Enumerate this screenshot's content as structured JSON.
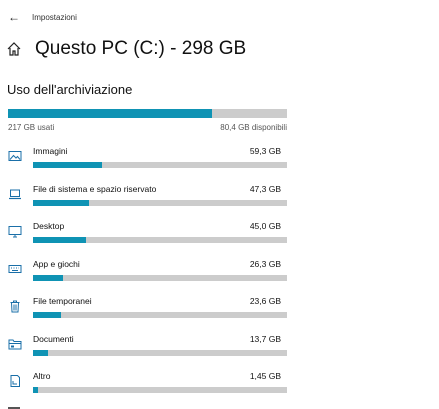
{
  "app": {
    "title": "Impostazioni"
  },
  "header": {
    "title": "Questo PC (C:) - 298 GB"
  },
  "usage": {
    "section_title": "Uso dell'archiviazione",
    "used_label": "217 GB usati",
    "free_label": "80,4 GB disponibili",
    "used_fraction": 0.73,
    "accent_color": "#0f93b4",
    "track_color": "#cccccc"
  },
  "categories": [
    {
      "name": "Immagini",
      "size": "59,3 GB",
      "icon": "image-icon",
      "fraction": 0.27
    },
    {
      "name": "File di sistema e spazio riservato",
      "size": "47,3 GB",
      "icon": "laptop-icon",
      "fraction": 0.22
    },
    {
      "name": "Desktop",
      "size": "45,0 GB",
      "icon": "monitor-icon",
      "fraction": 0.21
    },
    {
      "name": "App e giochi",
      "size": "26,3 GB",
      "icon": "keyboard-icon",
      "fraction": 0.12
    },
    {
      "name": "File temporanei",
      "size": "23,6 GB",
      "icon": "trash-icon",
      "fraction": 0.11
    },
    {
      "name": "Documenti",
      "size": "13,7 GB",
      "icon": "folder-icon",
      "fraction": 0.06
    },
    {
      "name": "Altro",
      "size": "1,45 GB",
      "icon": "other-file-icon",
      "fraction": 0.02
    }
  ]
}
